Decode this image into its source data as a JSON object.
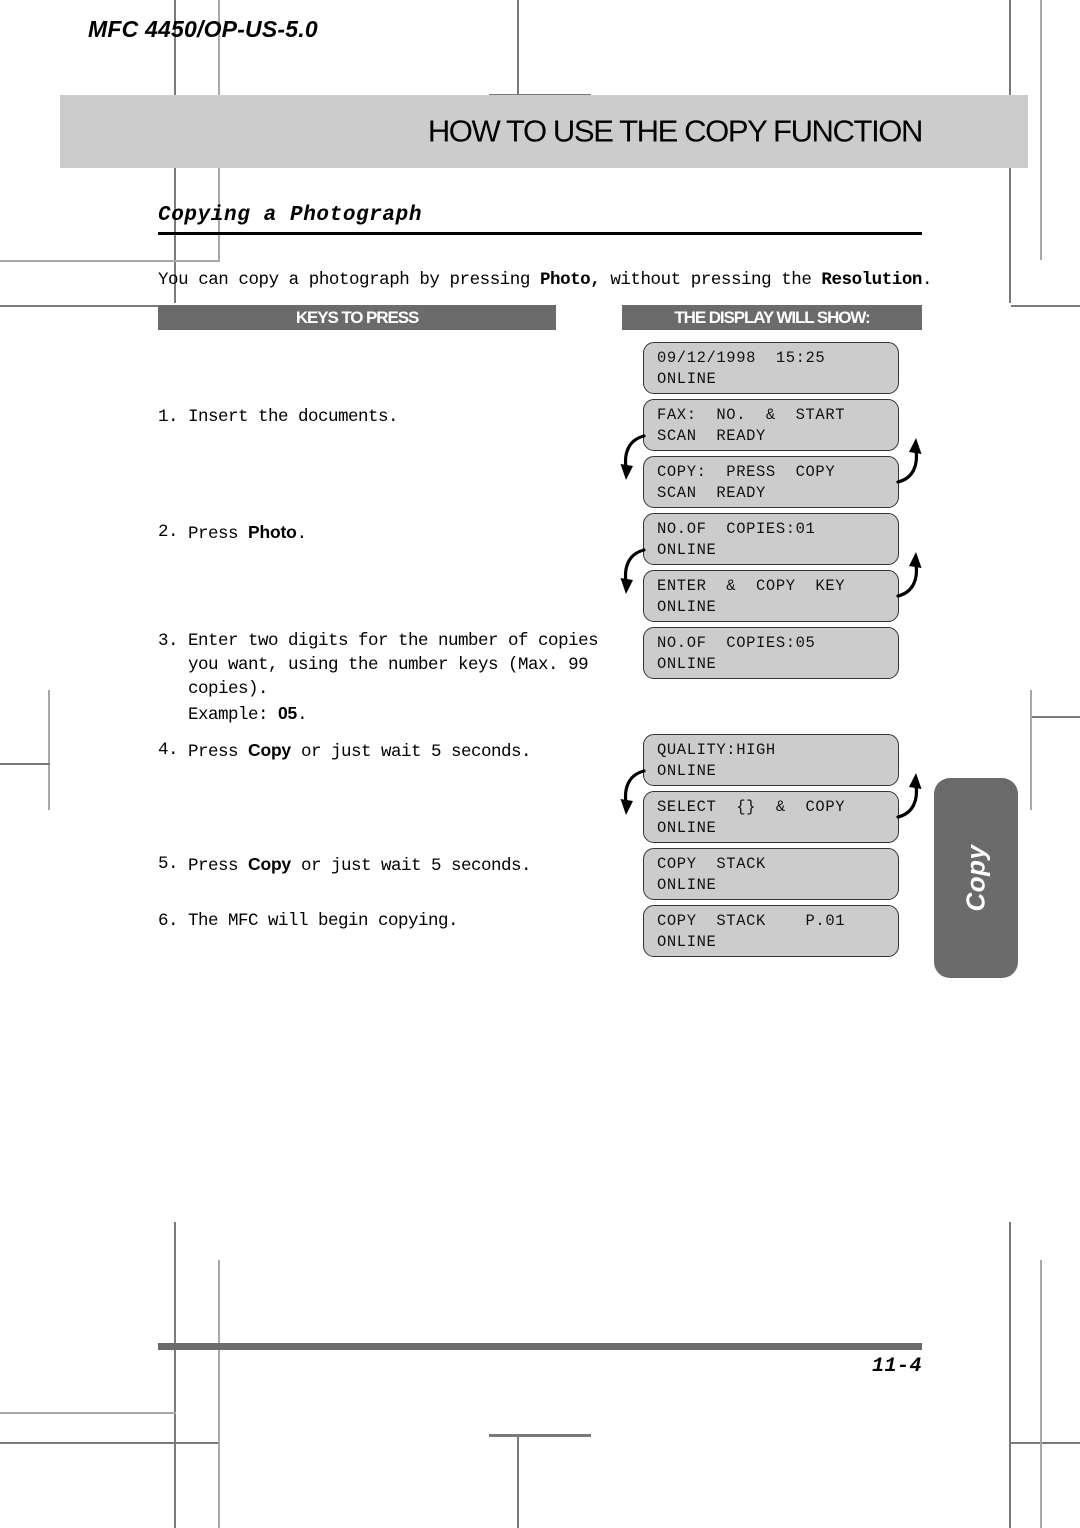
{
  "document": {
    "running_head": "MFC 4450/OP-US-5.0",
    "chapter_title": "HOW TO USE THE COPY FUNCTION",
    "section_heading": "Copying a Photograph",
    "page_number": "11-4",
    "thumb_tab_label": "Copy"
  },
  "intro": {
    "part1": "You can copy a photograph by pressing ",
    "key1": "Photo,",
    "part2": " without pressing the ",
    "key2": "Resolution",
    "part3": "."
  },
  "columns": {
    "keys_to_press": "KEYS TO PRESS",
    "display_will_show": "THE DISPLAY WILL SHOW:"
  },
  "steps": [
    {
      "num": "1.",
      "text": "Insert the documents."
    },
    {
      "num": "2.",
      "pre": "Press ",
      "key": "Photo",
      "post": "."
    },
    {
      "num": "3.",
      "line1": "Enter two digits for the number of copies",
      "line2": "you want, using the number keys (Max. 99",
      "line3": "copies).",
      "example_label": "Example: ",
      "example_value": "05",
      "example_post": "."
    },
    {
      "num": "4.",
      "pre": "Press ",
      "key": "Copy",
      "post": " or just wait 5 seconds."
    },
    {
      "num": "5.",
      "pre": "Press ",
      "key": "Copy",
      "post": " or just wait 5 seconds."
    },
    {
      "num": "6.",
      "text": "The MFC will begin copying."
    }
  ],
  "displays": [
    {
      "line1": "09/12/1998  15:25",
      "line2": "ONLINE"
    },
    {
      "line1": "FAX:  NO.  &  START",
      "line2": "SCAN  READY"
    },
    {
      "line1": "COPY:  PRESS  COPY",
      "line2": "SCAN  READY"
    },
    {
      "line1": "NO.OF  COPIES:01",
      "line2": "ONLINE"
    },
    {
      "line1": "ENTER  &  COPY  KEY",
      "line2": "ONLINE"
    },
    {
      "line1": "NO.OF  COPIES:05",
      "line2": "ONLINE"
    },
    {
      "line1": "QUALITY:HIGH",
      "line2": "ONLINE"
    },
    {
      "line1": "SELECT  {}  &  COPY",
      "line2": "ONLINE"
    },
    {
      "line1": "COPY  STACK",
      "line2": "ONLINE"
    },
    {
      "line1": "COPY  STACK    P.01",
      "line2": "ONLINE"
    }
  ],
  "colors": {
    "banner_gray": "#cccccc",
    "bar_gray": "#6b6b6b",
    "lcd_fill": "#cccccc",
    "lcd_border": "#333333"
  }
}
